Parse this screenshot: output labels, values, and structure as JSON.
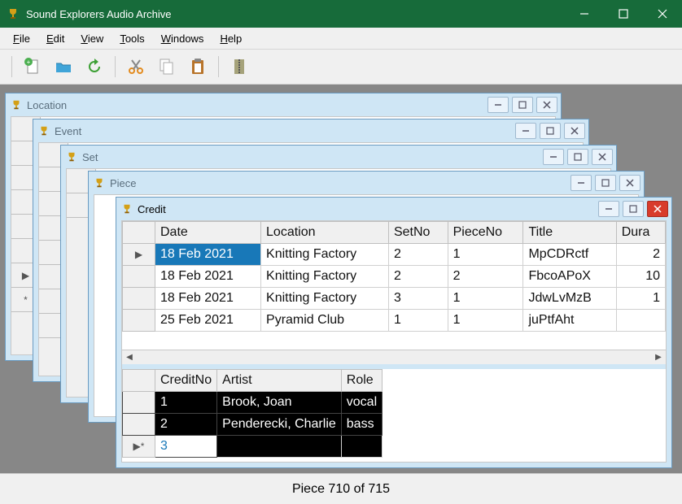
{
  "app": {
    "title": "Sound Explorers Audio Archive"
  },
  "menu": {
    "file": "File",
    "file_u": "F",
    "edit": "Edit",
    "edit_u": "E",
    "view": "View",
    "view_u": "V",
    "tools": "Tools",
    "tools_u": "T",
    "windows": "Windows",
    "windows_u": "W",
    "help": "Help",
    "help_u": "H"
  },
  "toolbar_icons": [
    "new-doc",
    "folder-open",
    "refresh",
    "cut",
    "copy",
    "paste",
    "zip"
  ],
  "mdi_windows": {
    "location": "Location",
    "event": "Event",
    "set": "Set",
    "piece": "Piece",
    "credit": "Credit"
  },
  "credit_grid": {
    "columns": [
      "Date",
      "Location",
      "SetNo",
      "PieceNo",
      "Title",
      "Dura"
    ],
    "rows": [
      {
        "date": "18 Feb 2021",
        "location": "Knitting Factory",
        "setno": "2",
        "pieceno": "1",
        "title": "MpCDRctf",
        "dur": "2",
        "selected": true
      },
      {
        "date": "18 Feb 2021",
        "location": "Knitting Factory",
        "setno": "2",
        "pieceno": "2",
        "title": "FbcoAPoX",
        "dur": "10"
      },
      {
        "date": "18 Feb 2021",
        "location": "Knitting Factory",
        "setno": "3",
        "pieceno": "1",
        "title": "JdwLvMzB",
        "dur": "1"
      },
      {
        "date": "25 Feb 2021",
        "location": "Pyramid Club",
        "setno": "1",
        "pieceno": "1",
        "title": "juPtfAht",
        "dur": ""
      }
    ]
  },
  "credit_sub": {
    "columns": [
      "CreditNo",
      "Artist",
      "Role"
    ],
    "rows": [
      {
        "no": "1",
        "artist": "Brook, Joan",
        "role": "vocal",
        "dark": true
      },
      {
        "no": "2",
        "artist": "Penderecki, Charlie",
        "role": "bass",
        "dark": true
      },
      {
        "no": "3",
        "artist": "",
        "role": "",
        "new": true
      }
    ]
  },
  "status": "Piece 710 of 715"
}
